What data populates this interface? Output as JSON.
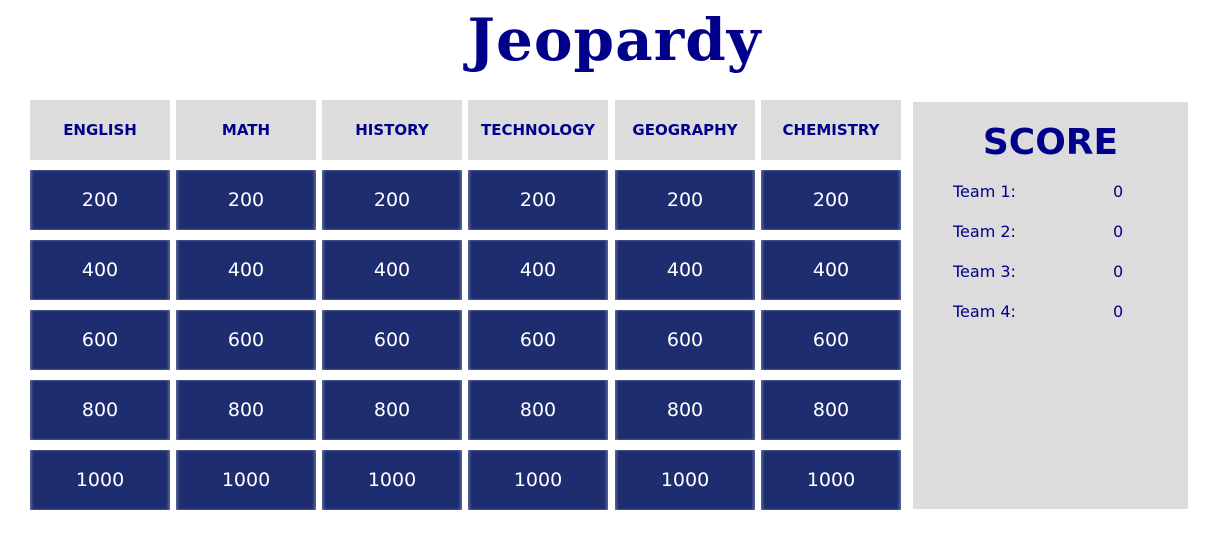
{
  "title": "Jeopardy",
  "colors": {
    "title": "#00008b",
    "category_bg": "#dcdcdc",
    "cell_bg": "#1e2d70",
    "cell_text": "#ffffff",
    "score_bg": "#dcdcdc"
  },
  "board": {
    "categories": [
      {
        "name": "ENGLISH",
        "values": [
          "200",
          "400",
          "600",
          "800",
          "1000"
        ]
      },
      {
        "name": "MATH",
        "values": [
          "200",
          "400",
          "600",
          "800",
          "1000"
        ]
      },
      {
        "name": "HISTORY",
        "values": [
          "200",
          "400",
          "600",
          "800",
          "1000"
        ]
      },
      {
        "name": "TECHNOLOGY",
        "values": [
          "200",
          "400",
          "600",
          "800",
          "1000"
        ]
      },
      {
        "name": "GEOGRAPHY",
        "values": [
          "200",
          "400",
          "600",
          "800",
          "1000"
        ]
      },
      {
        "name": "CHEMISTRY",
        "values": [
          "200",
          "400",
          "600",
          "800",
          "1000"
        ]
      }
    ]
  },
  "score": {
    "title": "SCORE",
    "teams": [
      {
        "label": "Team 1:",
        "score": "0"
      },
      {
        "label": "Team 2:",
        "score": "0"
      },
      {
        "label": "Team 3:",
        "score": "0"
      },
      {
        "label": "Team 4:",
        "score": "0"
      }
    ]
  }
}
